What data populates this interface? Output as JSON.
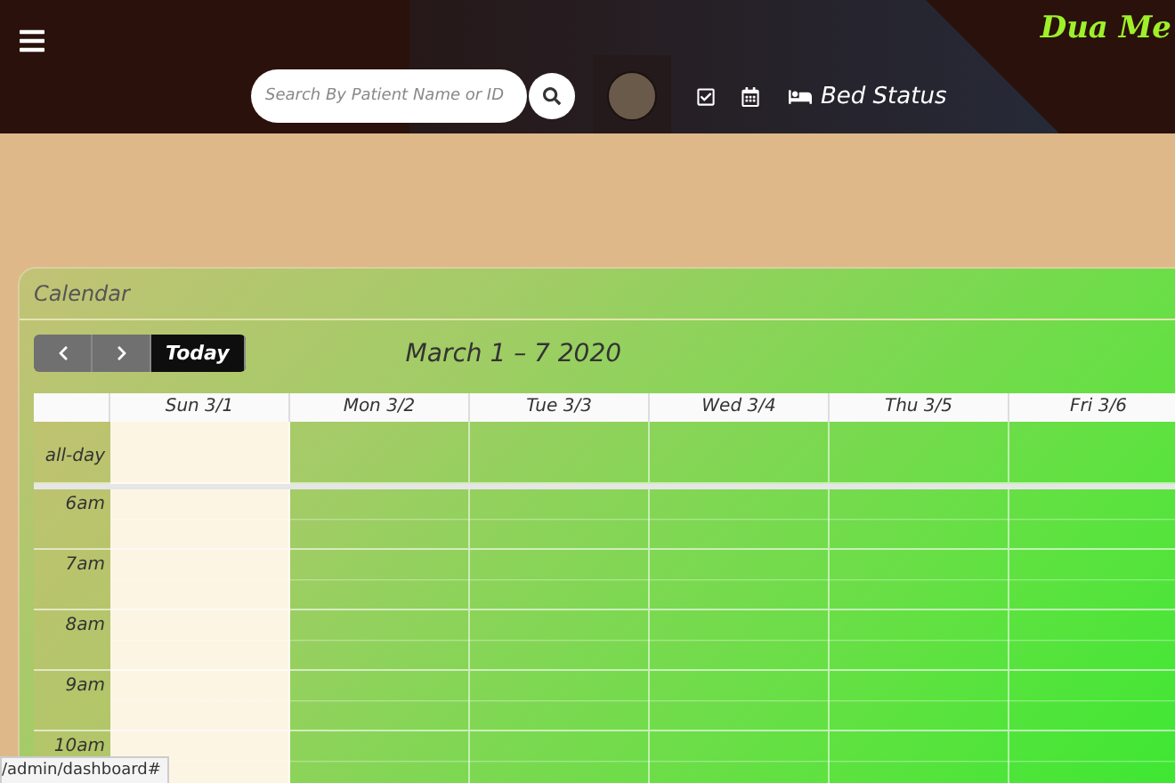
{
  "header": {
    "brand": "Dua Me",
    "search": {
      "placeholder": "Search By Patient Name or ID"
    },
    "bed_status": "Bed Status"
  },
  "calendar": {
    "title": "Calendar",
    "today_button": "Today",
    "range_title": "March 1 – 7 2020",
    "all_day_label": "all-day",
    "days": [
      {
        "label": "Sun 3/1",
        "today": true
      },
      {
        "label": "Mon 3/2",
        "today": false
      },
      {
        "label": "Tue 3/3",
        "today": false
      },
      {
        "label": "Wed 3/4",
        "today": false
      },
      {
        "label": "Thu 3/5",
        "today": false
      },
      {
        "label": "Fri 3/6",
        "today": false
      }
    ],
    "times": [
      "6am",
      "7am",
      "8am",
      "9am",
      "10am"
    ]
  },
  "status_bar": {
    "url": "/admin/dashboard#"
  }
}
